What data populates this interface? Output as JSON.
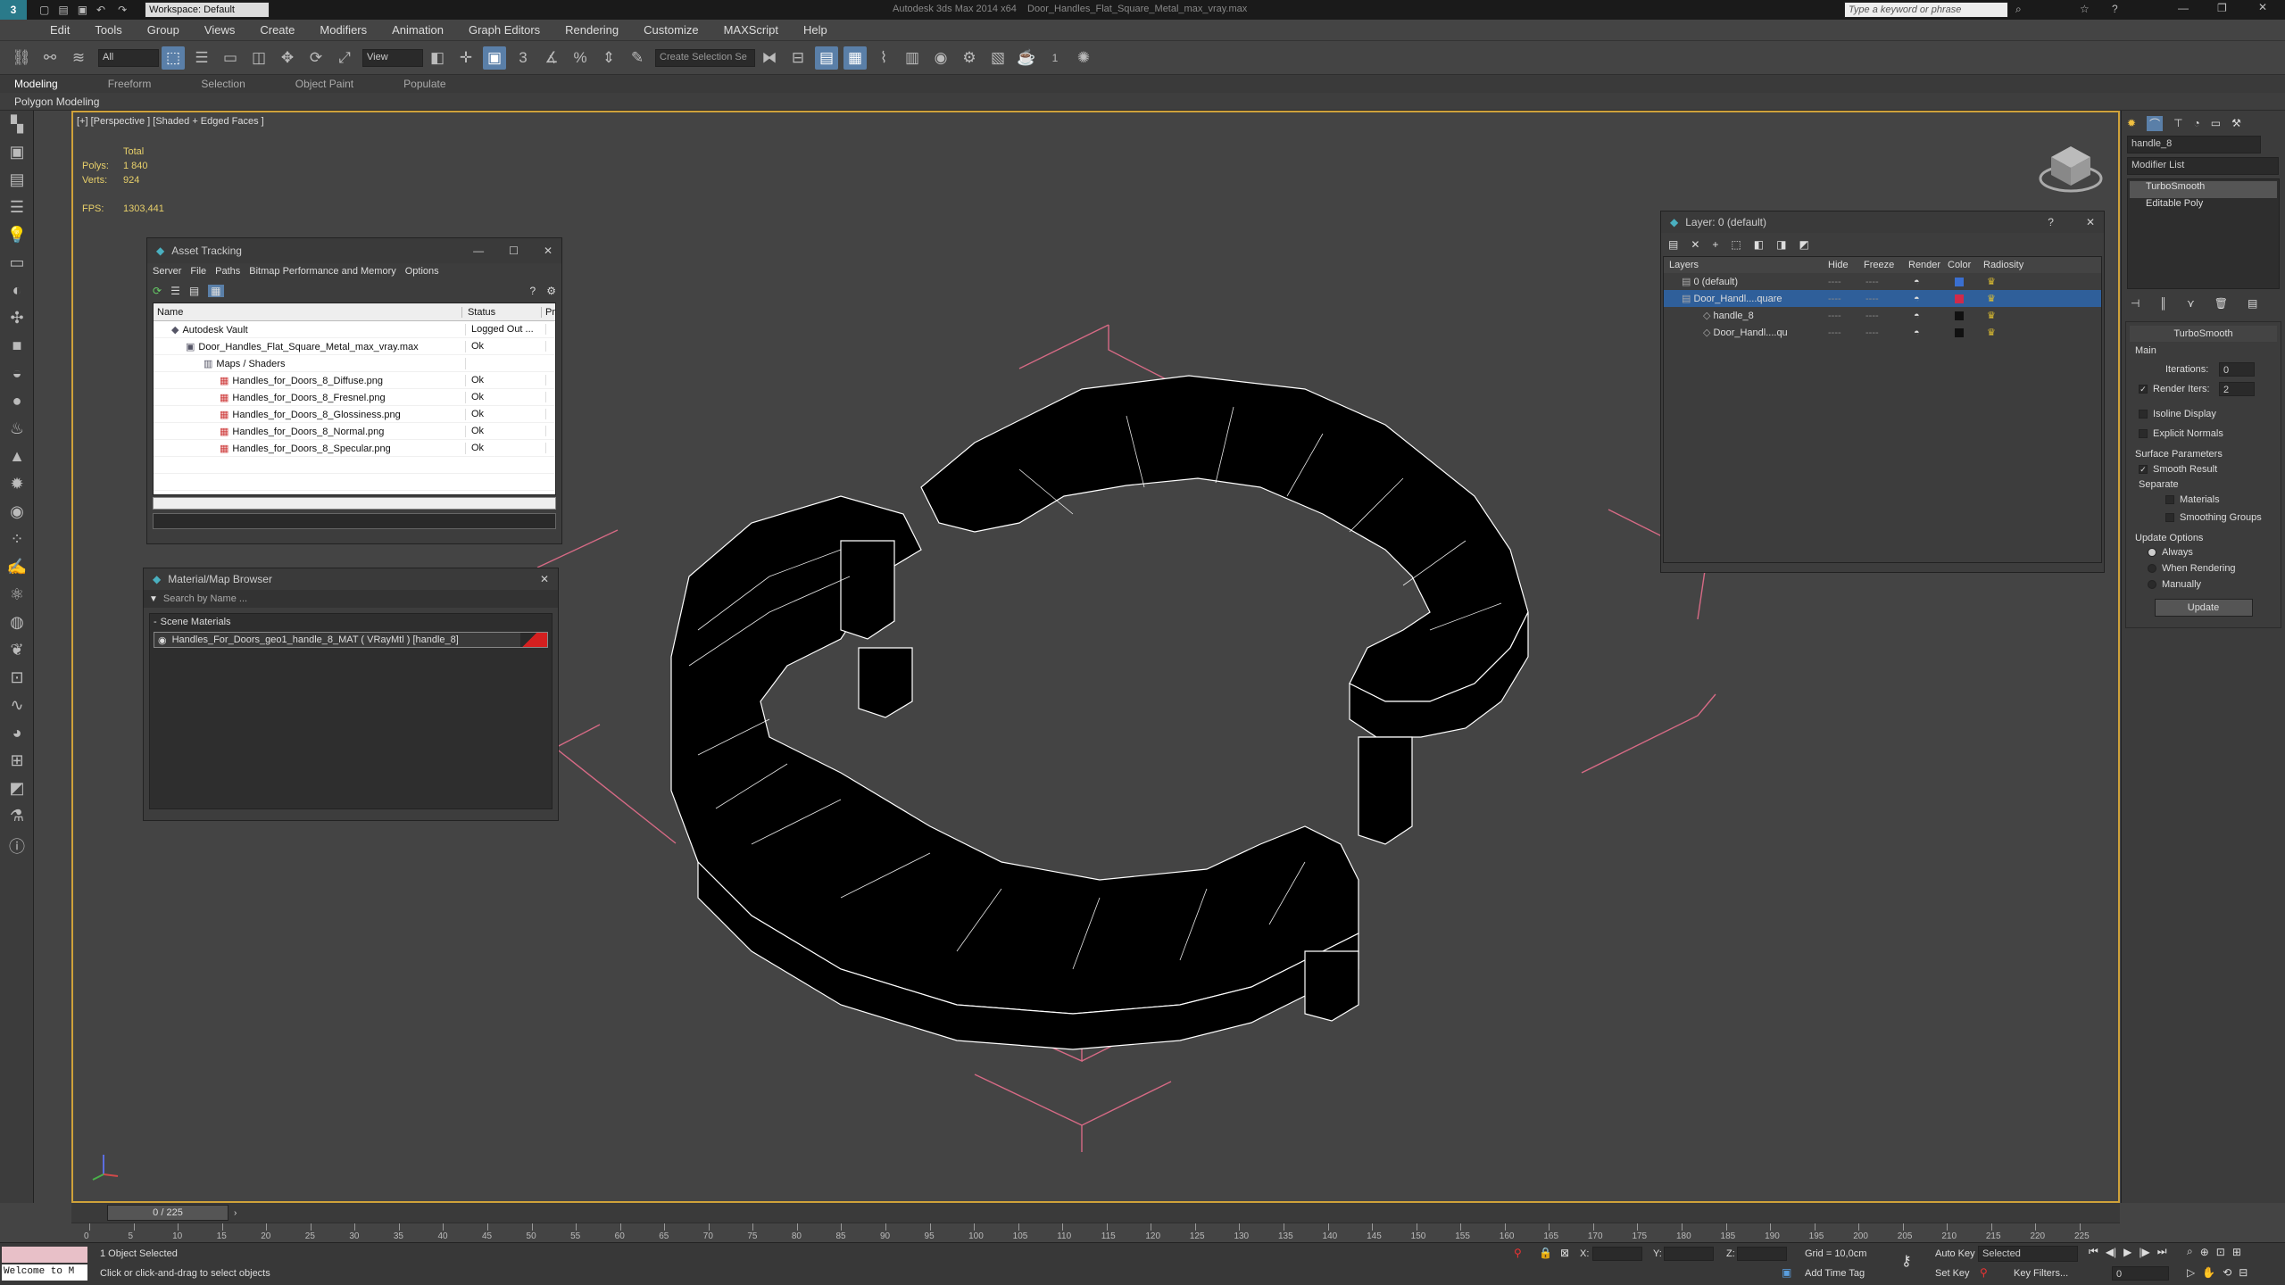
{
  "window": {
    "workspace": "Workspace: Default",
    "title": "Autodesk 3ds Max 2014 x64",
    "filename": "Door_Handles_Flat_Square_Metal_max_vray.max",
    "search_placeholder": "Type a keyword or phrase"
  },
  "menu": [
    "Edit",
    "Tools",
    "Group",
    "Views",
    "Create",
    "Modifiers",
    "Animation",
    "Graph Editors",
    "Rendering",
    "Customize",
    "MAXScript",
    "Help"
  ],
  "toolbar": {
    "filter": "All",
    "ref_coord": "View",
    "selection_set": "Create Selection Se",
    "spinner_value": "1"
  },
  "ribbon": {
    "tabs": [
      "Modeling",
      "Freeform",
      "Selection",
      "Object Paint",
      "Populate"
    ],
    "sub": "Polygon Modeling"
  },
  "viewport": {
    "label": "[+] [Perspective ] [Shaded + Edged Faces ]",
    "stats_total": "Total",
    "polys_label": "Polys:",
    "polys_value": "1 840",
    "verts_label": "Verts:",
    "verts_value": "924",
    "fps_label": "FPS:",
    "fps_value": "1303,441"
  },
  "asset_tracking": {
    "title": "Asset Tracking",
    "menu": [
      "Server",
      "File",
      "Paths",
      "Bitmap Performance and Memory",
      "Options"
    ],
    "col_name": "Name",
    "col_status": "Status",
    "col_pr": "Pr",
    "rows": [
      {
        "name": "Autodesk Vault",
        "status": "Logged Out ..."
      },
      {
        "name": "Door_Handles_Flat_Square_Metal_max_vray.max",
        "status": "Ok"
      },
      {
        "name": "Maps / Shaders",
        "status": ""
      },
      {
        "name": "Handles_for_Doors_8_Diffuse.png",
        "status": "Ok"
      },
      {
        "name": "Handles_for_Doors_8_Fresnel.png",
        "status": "Ok"
      },
      {
        "name": "Handles_for_Doors_8_Glossiness.png",
        "status": "Ok"
      },
      {
        "name": "Handles_for_Doors_8_Normal.png",
        "status": "Ok"
      },
      {
        "name": "Handles_for_Doors_8_Specular.png",
        "status": "Ok"
      }
    ]
  },
  "material_browser": {
    "title": "Material/Map Browser",
    "search_placeholder": "Search by Name ...",
    "section": "Scene Materials",
    "item": "Handles_For_Doors_geo1_handle_8_MAT ( VRayMtl ) [handle_8]"
  },
  "layer_manager": {
    "title": "Layer: 0 (default)",
    "help": "?",
    "cols": [
      "Layers",
      "Hide",
      "Freeze",
      "Render",
      "Color",
      "Radiosity"
    ],
    "rows": [
      {
        "name": "0 (default)",
        "color": "#3a6fd0",
        "hide": "----",
        "freeze": "----",
        "render": "◓"
      },
      {
        "name": "Door_Handl....quare",
        "color": "#d02a4a",
        "hide": "----",
        "freeze": "----",
        "render": "◓"
      },
      {
        "name": "handle_8",
        "color": "#111111",
        "hide": "----",
        "freeze": "----",
        "render": "◓"
      },
      {
        "name": "Door_Handl....qu",
        "color": "#111111",
        "hide": "----",
        "freeze": "----",
        "render": "◓"
      }
    ]
  },
  "command_panel": {
    "object_name": "handle_8",
    "modifier_list": "Modifier List",
    "stack": [
      "TurboSmooth",
      "Editable Poly"
    ],
    "rollout_title": "TurboSmooth",
    "main": "Main",
    "iterations_label": "Iterations:",
    "iterations_value": "0",
    "render_iters_label": "Render Iters:",
    "render_iters_value": "2",
    "isoline": "Isoline Display",
    "explicit": "Explicit Normals",
    "surface_params": "Surface Parameters",
    "smooth_result": "Smooth Result",
    "separate": "Separate",
    "materials": "Materials",
    "smoothing_groups": "Smoothing Groups",
    "update_options": "Update Options",
    "always": "Always",
    "when_rendering": "When Rendering",
    "manually": "Manually",
    "update": "Update"
  },
  "timeline": {
    "frame_counter": "0 / 225",
    "ticks": [
      "0",
      "5",
      "10",
      "15",
      "20",
      "25",
      "30",
      "35",
      "40",
      "45",
      "50",
      "55",
      "60",
      "65",
      "70",
      "75",
      "80",
      "85",
      "90",
      "95",
      "100",
      "105",
      "110",
      "115",
      "120",
      "125",
      "130",
      "135",
      "140",
      "145",
      "150",
      "155",
      "160",
      "165",
      "170",
      "175",
      "180",
      "185",
      "190",
      "195",
      "200",
      "205",
      "210",
      "215",
      "220",
      "225"
    ]
  },
  "status": {
    "welcome": "Welcome to M",
    "selected": "1 Object Selected",
    "prompt": "Click or click-and-drag to select objects",
    "x_label": "X:",
    "y_label": "Y:",
    "z_label": "Z:",
    "grid": "Grid = 10,0cm",
    "auto_key": "Auto Key",
    "key_mode": "Selected",
    "set_key": "Set Key",
    "key_filters": "Key Filters...",
    "add_time_tag": "Add Time Tag",
    "current_frame": "0"
  }
}
